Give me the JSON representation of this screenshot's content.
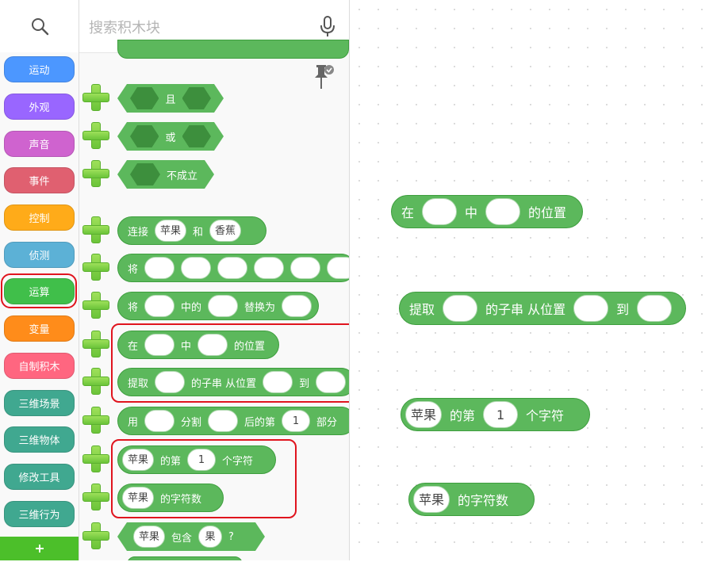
{
  "search": {
    "placeholder": "搜索积木块"
  },
  "categories": [
    {
      "label": "运动",
      "color": "#4c97ff"
    },
    {
      "label": "外观",
      "color": "#9966ff"
    },
    {
      "label": "声音",
      "color": "#cf63cf"
    },
    {
      "label": "事件",
      "color": "#e06070"
    },
    {
      "label": "控制",
      "color": "#ffab19"
    },
    {
      "label": "侦测",
      "color": "#5cb1d6"
    },
    {
      "label": "运算",
      "color": "#40bf4a"
    },
    {
      "label": "变量",
      "color": "#ff8c1a"
    },
    {
      "label": "自制积木",
      "color": "#ff6680"
    },
    {
      "label": "三维场景",
      "color": "#40a890"
    },
    {
      "label": "三维物体",
      "color": "#40a890"
    },
    {
      "label": "修改工具",
      "color": "#40a890"
    },
    {
      "label": "三维行为",
      "color": "#40a890"
    }
  ],
  "colors": {
    "operator_block": "#5cb85c",
    "highlight": "#e0141e"
  },
  "palette": {
    "and_label": "且",
    "or_label": "或",
    "not_label": "不成立",
    "join": {
      "label": "连接",
      "a": "苹果",
      "mid": "和",
      "b": "香蕉"
    },
    "set_label": "将",
    "replace": {
      "p1": "将",
      "p2": "中的",
      "p3": "替换为"
    },
    "position_of": {
      "p1": "在",
      "p2": "中",
      "p3": "的位置"
    },
    "substring": {
      "p1": "提取",
      "p2": "的子串 从位置",
      "p3": "到"
    },
    "split": {
      "p1": "用",
      "p2": "分割",
      "p3": "后的第",
      "n": "1",
      "p4": "部分"
    },
    "char_at": {
      "s": "苹果",
      "p1": "的第",
      "n": "1",
      "p2": "个字符"
    },
    "length": {
      "s": "苹果",
      "p1": "的字符数"
    },
    "contains": {
      "s": "苹果",
      "p1": "包含",
      "t": "果",
      "q": "?"
    }
  },
  "workspace": {
    "position_of": {
      "p1": "在",
      "p2": "中",
      "p3": "的位置"
    },
    "substring": {
      "p1": "提取",
      "p2": "的子串 从位置",
      "p3": "到"
    },
    "char_at": {
      "s": "苹果",
      "p1": "的第",
      "n": "1",
      "p2": "个字符"
    },
    "length": {
      "s": "苹果",
      "p1": "的字符数"
    }
  }
}
